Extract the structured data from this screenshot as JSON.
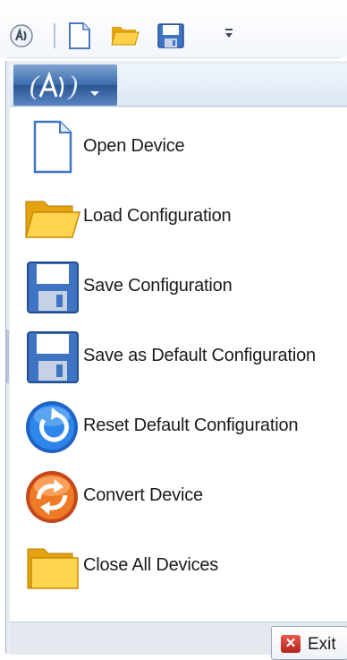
{
  "toolbar": {
    "items": [
      "app-logo",
      "new-document",
      "open-folder",
      "save",
      "customize"
    ]
  },
  "menu": {
    "items": [
      {
        "name": "open-device",
        "label": "Open Device",
        "icon": "page-icon"
      },
      {
        "name": "load-configuration",
        "label": "Load Configuration",
        "icon": "folder-open-icon"
      },
      {
        "name": "save-configuration",
        "label": "Save Configuration",
        "icon": "floppy-disk-icon"
      },
      {
        "name": "save-default-configuration",
        "label": "Save as Default Configuration",
        "icon": "floppy-disk-icon"
      },
      {
        "name": "reset-default-configuration",
        "label": "Reset Default Configuration",
        "icon": "reset-icon"
      },
      {
        "name": "convert-device",
        "label": "Convert Device",
        "icon": "convert-icon"
      },
      {
        "name": "close-all-devices",
        "label": "Close All Devices",
        "icon": "folder-icon"
      }
    ],
    "exit_label": "Exit"
  },
  "colors": {
    "app_button": "#3f6eae",
    "menu_background": "#e9edf3",
    "exit_icon": "#c8372b"
  }
}
